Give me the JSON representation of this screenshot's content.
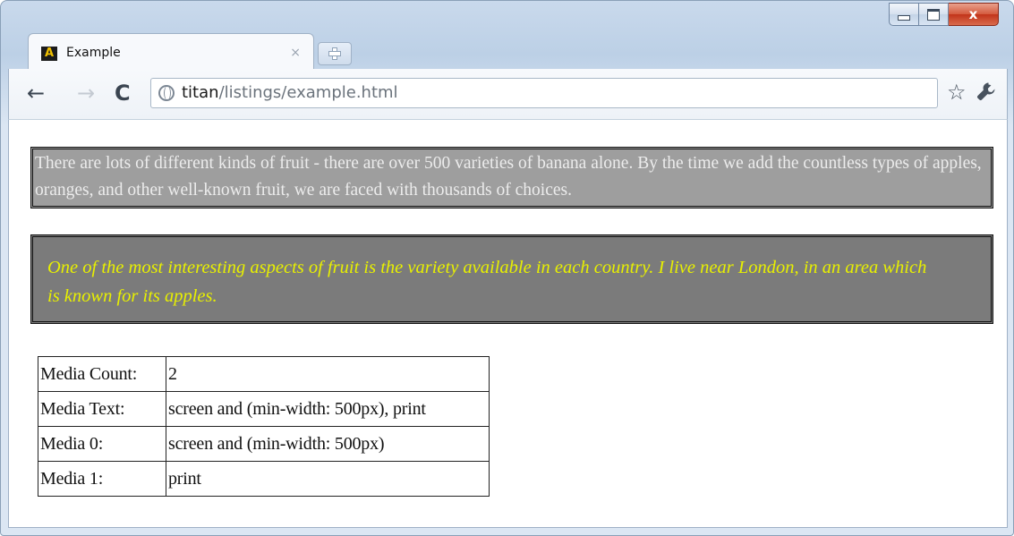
{
  "window": {
    "controls": {
      "minimize": "minimize",
      "maximize": "maximize",
      "close": "x"
    }
  },
  "tab": {
    "favicon_letter": "A",
    "title": "Example",
    "close_glyph": "×"
  },
  "toolbar": {
    "back_glyph": "←",
    "forward_glyph": "→",
    "reload_glyph": "C",
    "url_host": "titan",
    "url_path": "/listings/example.html",
    "star_glyph": "☆",
    "wrench_glyph": "🔧"
  },
  "content": {
    "paragraph1": "There are lots of different kinds of fruit - there are over 500 varieties of banana alone. By the time we add the countless types of apples, oranges, and other well-known fruit, we are faced with thousands of choices.",
    "paragraph2": "One of the most interesting aspects of fruit is the variety available in each country. I live near London, in an area which is known for its apples.",
    "table": [
      {
        "key": "Media Count:",
        "value": "2"
      },
      {
        "key": "Media Text:",
        "value": "screen and (min-width: 500px), print"
      },
      {
        "key": "Media 0:",
        "value": "screen and (min-width: 500px)"
      },
      {
        "key": "Media 1:",
        "value": "print"
      }
    ]
  },
  "colors": {
    "box1_bg": "#9e9e9e",
    "box1_text": "#ececec",
    "box2_bg": "#7b7b7b",
    "box2_text": "#e8f000"
  }
}
